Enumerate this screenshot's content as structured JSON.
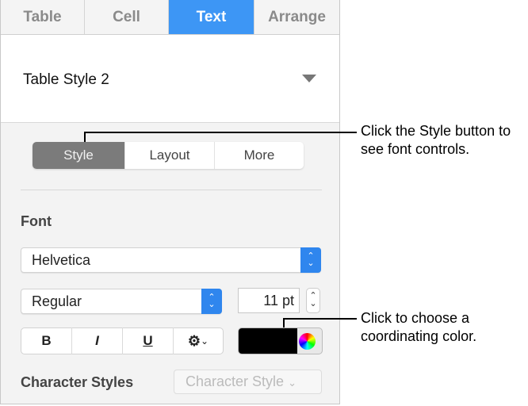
{
  "tabs": [
    {
      "label": "Table"
    },
    {
      "label": "Cell"
    },
    {
      "label": "Text"
    },
    {
      "label": "Arrange"
    }
  ],
  "paragraph_style": {
    "value": "Table Style 2"
  },
  "segments": [
    {
      "label": "Style"
    },
    {
      "label": "Layout"
    },
    {
      "label": "More"
    }
  ],
  "font": {
    "heading": "Font",
    "family": "Helvetica",
    "typeface": "Regular",
    "size": "11 pt"
  },
  "format_buttons": {
    "bold": "B",
    "italic": "I",
    "underline": "U"
  },
  "text_color": "#000000",
  "character_styles": {
    "label": "Character Styles",
    "placeholder": "Character Style"
  },
  "callouts": [
    "Click the Style button to see font controls.",
    "Click to choose a coordinating color."
  ]
}
